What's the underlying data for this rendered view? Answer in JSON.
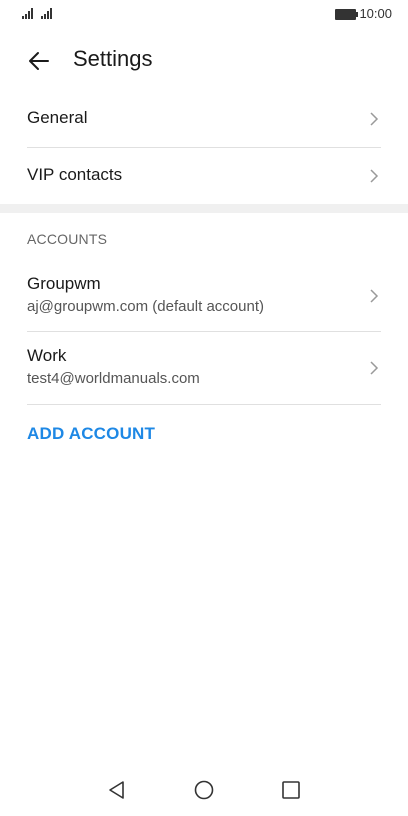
{
  "status": {
    "time": "10:00"
  },
  "header": {
    "title": "Settings"
  },
  "menu": [
    {
      "label": "General"
    },
    {
      "label": "VIP contacts"
    }
  ],
  "accounts_section": {
    "title": "ACCOUNTS"
  },
  "accounts": [
    {
      "name": "Groupwm",
      "email": "aj@groupwm.com (default account)"
    },
    {
      "name": "Work",
      "email": "test4@worldmanuals.com"
    }
  ],
  "add_account": {
    "label": "ADD ACCOUNT"
  },
  "colors": {
    "accent": "#1e88e5",
    "divider": "#e0e0e0",
    "band": "#f0f0f0"
  },
  "icons": {
    "back": "arrow-left-icon",
    "chevron": "chevron-right-icon",
    "nav": [
      "nav-back-icon",
      "nav-home-icon",
      "nav-recents-icon"
    ]
  }
}
